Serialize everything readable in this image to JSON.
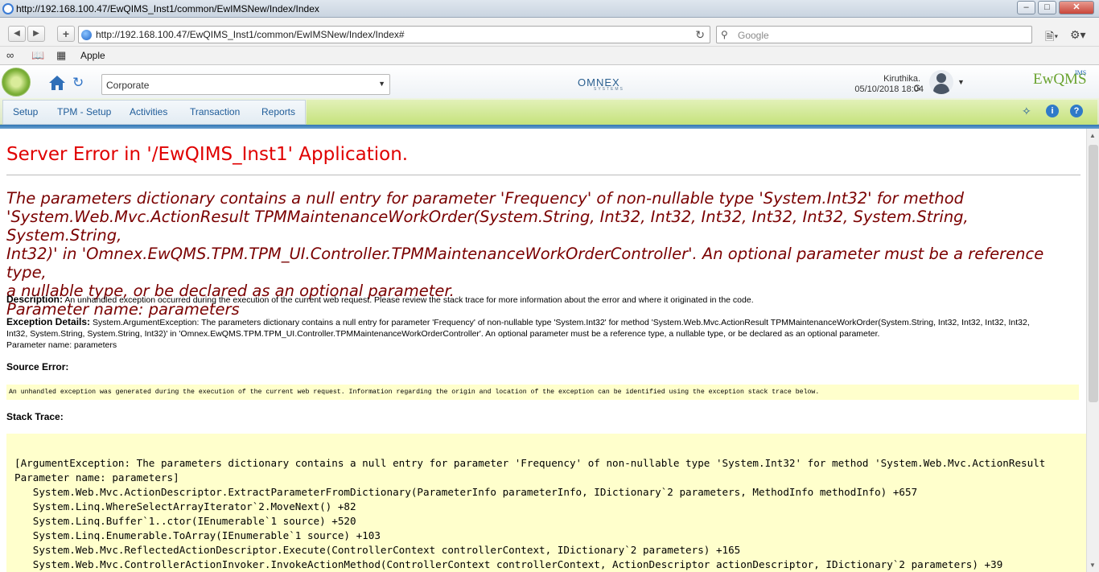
{
  "window": {
    "title": "http://192.168.100.47/EwQIMS_Inst1/common/EwIMSNew/Index/Index"
  },
  "browser": {
    "url": "http://192.168.100.47/EwQIMS_Inst1/common/EwIMSNew/Index/Index#",
    "search_placeholder": "Google",
    "bookmark_label": "Apple"
  },
  "app": {
    "plant_select": "Corporate",
    "brand": "OMNEX",
    "brand_sub": "SYSTEMS",
    "product": "EwQMS",
    "product_ims": "IMS",
    "user_name": "Kiruthika. G",
    "user_datetime": "05/10/2018 18:04",
    "menu": [
      "Setup",
      "TPM - Setup",
      "Activities",
      "Transaction",
      "Reports"
    ]
  },
  "error": {
    "title": "Server Error in '/EwQIMS_Inst1' Application.",
    "message_lines": [
      "The parameters dictionary contains a null entry for parameter 'Frequency' of non-nullable type 'System.Int32' for method",
      "'System.Web.Mvc.ActionResult TPMMaintenanceWorkOrder(System.String, Int32, Int32, Int32, Int32, Int32, System.String, System.String,",
      "Int32)' in 'Omnex.EwQMS.TPM.TPM_UI.Controller.TPMMaintenanceWorkOrderController'. An optional parameter must be a reference type,",
      "a nullable type, or be declared as an optional parameter.",
      "Parameter name: parameters"
    ],
    "description_label": "Description:",
    "description_text": "An unhandled exception occurred during the execution of the current web request. Please review the stack trace for more information about the error and where it originated in the code.",
    "exception_label": "Exception Details:",
    "exception_lines": [
      "System.ArgumentException: The parameters dictionary contains a null entry for parameter 'Frequency' of non-nullable type 'System.Int32' for method 'System.Web.Mvc.ActionResult TPMMaintenanceWorkOrder(System.String, Int32, Int32, Int32, Int32,",
      "Int32, System.String, System.String, Int32)' in 'Omnex.EwQMS.TPM.TPM_UI.Controller.TPMMaintenanceWorkOrderController'. An optional parameter must be a reference type, a nullable type, or be declared as an optional parameter.",
      "Parameter name: parameters"
    ],
    "source_error_label": "Source Error:",
    "source_error_text": "An unhandled exception was generated during the execution of the current web request. Information regarding the origin and location of the exception can be identified using the exception stack trace below.",
    "stack_trace_label": "Stack Trace:",
    "stack_lines": [
      "[ArgumentException: The parameters dictionary contains a null entry for parameter 'Frequency' of non-nullable type 'System.Int32' for method 'System.Web.Mvc.ActionResult",
      "Parameter name: parameters]",
      "   System.Web.Mvc.ActionDescriptor.ExtractParameterFromDictionary(ParameterInfo parameterInfo, IDictionary`2 parameters, MethodInfo methodInfo) +657",
      "   System.Linq.WhereSelectArrayIterator`2.MoveNext() +82",
      "   System.Linq.Buffer`1..ctor(IEnumerable`1 source) +520",
      "   System.Linq.Enumerable.ToArray(IEnumerable`1 source) +103",
      "   System.Web.Mvc.ReflectedActionDescriptor.Execute(ControllerContext controllerContext, IDictionary`2 parameters) +165",
      "   System.Web.Mvc.ControllerActionInvoker.InvokeActionMethod(ControllerContext controllerContext, ActionDescriptor actionDescriptor, IDictionary`2 parameters) +39"
    ]
  },
  "colors": {
    "error_title": "#e00000",
    "error_message": "#7a0000",
    "code_bg": "#ffffcc",
    "menu_text": "#1f5c99"
  }
}
